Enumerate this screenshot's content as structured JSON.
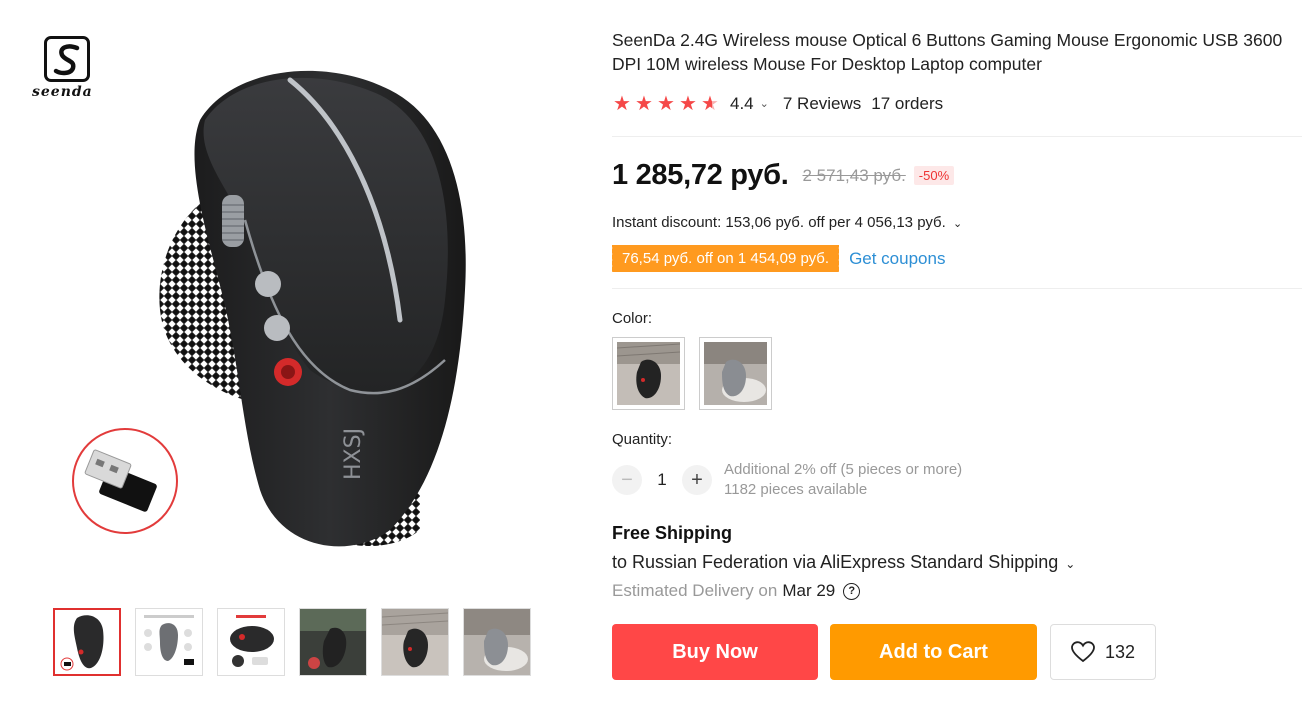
{
  "brand": {
    "logo_text": "seenda"
  },
  "product": {
    "title": "SeenDa 2.4G Wireless mouse Optical 6 Buttons Gaming Mouse Ergonomic USB 3600 DPI 10M wireless Mouse For Desktop Laptop computer",
    "rating": 4.4,
    "rating_text": "4.4",
    "reviews_text": "7 Reviews",
    "orders_text": "17 orders"
  },
  "pricing": {
    "price": "1 285,72 руб.",
    "old_price": "2 571,43 руб.",
    "discount": "-50%",
    "instant_discount": "Instant discount: 153,06 руб. off per 4 056,13 руб.",
    "coupon": "76,54 руб. off on 1 454,09 руб.",
    "get_coupons": "Get coupons"
  },
  "color": {
    "label": "Color:"
  },
  "quantity": {
    "label": "Quantity:",
    "value": "1",
    "minus": "−",
    "plus": "+",
    "additional_off": "Additional 2% off (5 pieces or more)",
    "available": "1182 pieces available"
  },
  "shipping": {
    "title": "Free Shipping",
    "to": "to Russian Federation via AliExpress Standard Shipping",
    "estimated_label": "Estimated Delivery on",
    "estimated_date": "Mar 29",
    "help_icon": "?"
  },
  "actions": {
    "buy_now": "Buy Now",
    "add_to_cart": "Add to Cart",
    "wishlist_count": "132"
  },
  "colors": {
    "star": "#f54848",
    "buy": "#ff4747",
    "cart": "#ff9a00",
    "link": "#2d8fd5",
    "coupon": "#ff9a1f"
  }
}
